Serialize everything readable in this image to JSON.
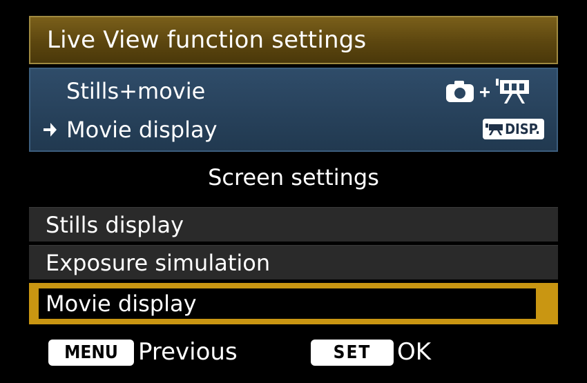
{
  "title": "Live View function settings",
  "info": {
    "shooting_mode": {
      "label": "Stills+movie",
      "icon": "camera-plus-movie-icon"
    },
    "current_display": {
      "label": "Movie display",
      "icon": "movie-disp-icon",
      "badge_text": "DISP."
    }
  },
  "section_heading": "Screen settings",
  "menu": {
    "items": [
      {
        "label": "Stills display",
        "selected": false
      },
      {
        "label": "Exposure simulation",
        "selected": false
      },
      {
        "label": "Movie display",
        "selected": true
      }
    ]
  },
  "footer": {
    "menu_button": "MENU",
    "menu_action": "Previous",
    "set_button": "SET",
    "set_action": "OK"
  },
  "colors": {
    "title_bg": "#5c460f",
    "info_bg": "#2a4560",
    "highlight": "#c99612",
    "item_bg": "#2a2a2a"
  }
}
